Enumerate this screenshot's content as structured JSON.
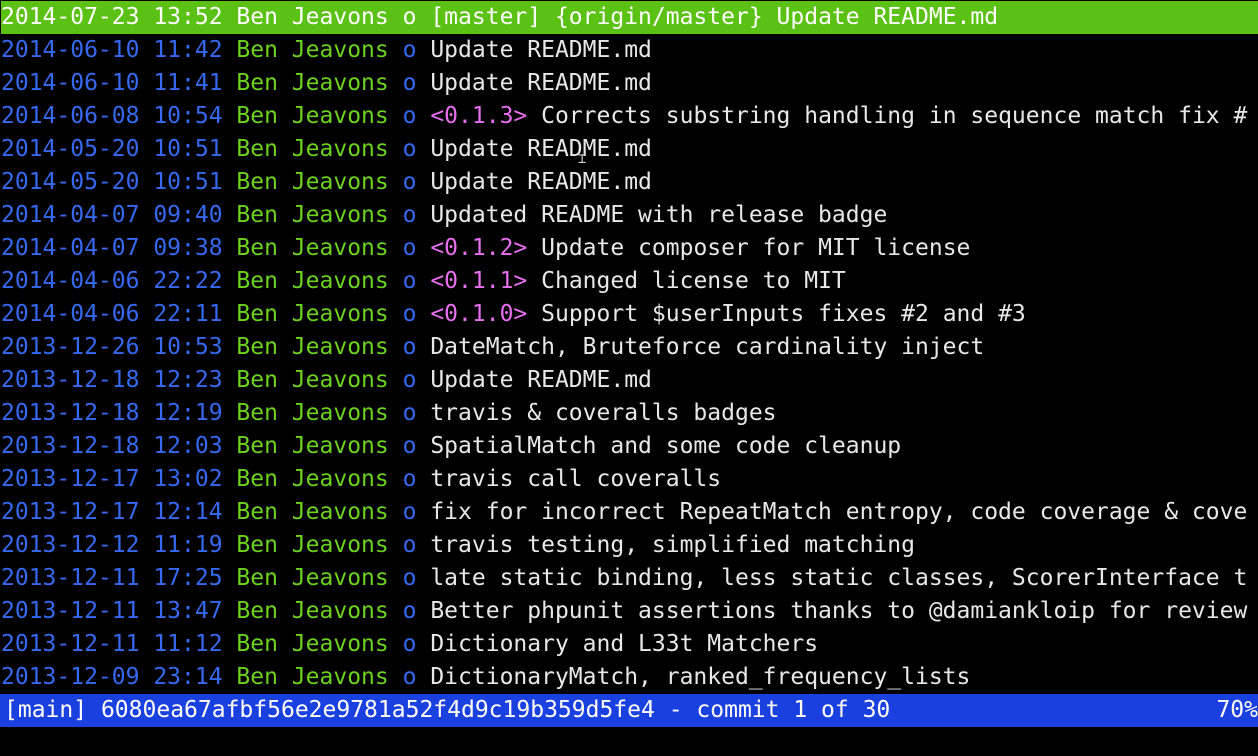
{
  "app": "tig",
  "commits": [
    {
      "date": "2014-07-23 13:52",
      "author": "Ben Jeavons",
      "graph": "o",
      "refs": "[master] {origin/master}",
      "tag": "",
      "subject": "Update README.md",
      "selected": true
    },
    {
      "date": "2014-06-10 11:42",
      "author": "Ben Jeavons",
      "graph": "o",
      "refs": "",
      "tag": "",
      "subject": "Update README.md"
    },
    {
      "date": "2014-06-10 11:41",
      "author": "Ben Jeavons",
      "graph": "o",
      "refs": "",
      "tag": "",
      "subject": "Update README.md"
    },
    {
      "date": "2014-06-08 10:54",
      "author": "Ben Jeavons",
      "graph": "o",
      "refs": "",
      "tag": "<0.1.3>",
      "subject": "Corrects substring handling in sequence match fix #"
    },
    {
      "date": "2014-05-20 10:51",
      "author": "Ben Jeavons",
      "graph": "o",
      "refs": "",
      "tag": "",
      "subject": "Update README.md"
    },
    {
      "date": "2014-05-20 10:51",
      "author": "Ben Jeavons",
      "graph": "o",
      "refs": "",
      "tag": "",
      "subject": "Update README.md"
    },
    {
      "date": "2014-04-07 09:40",
      "author": "Ben Jeavons",
      "graph": "o",
      "refs": "",
      "tag": "",
      "subject": "Updated README with release badge"
    },
    {
      "date": "2014-04-07 09:38",
      "author": "Ben Jeavons",
      "graph": "o",
      "refs": "",
      "tag": "<0.1.2>",
      "subject": "Update composer for MIT license"
    },
    {
      "date": "2014-04-06 22:22",
      "author": "Ben Jeavons",
      "graph": "o",
      "refs": "",
      "tag": "<0.1.1>",
      "subject": "Changed license to MIT"
    },
    {
      "date": "2014-04-06 22:11",
      "author": "Ben Jeavons",
      "graph": "o",
      "refs": "",
      "tag": "<0.1.0>",
      "subject": "Support $userInputs fixes #2 and #3"
    },
    {
      "date": "2013-12-26 10:53",
      "author": "Ben Jeavons",
      "graph": "o",
      "refs": "",
      "tag": "",
      "subject": "DateMatch, Bruteforce cardinality inject"
    },
    {
      "date": "2013-12-18 12:23",
      "author": "Ben Jeavons",
      "graph": "o",
      "refs": "",
      "tag": "",
      "subject": "Update README.md"
    },
    {
      "date": "2013-12-18 12:19",
      "author": "Ben Jeavons",
      "graph": "o",
      "refs": "",
      "tag": "",
      "subject": "travis & coveralls badges"
    },
    {
      "date": "2013-12-18 12:03",
      "author": "Ben Jeavons",
      "graph": "o",
      "refs": "",
      "tag": "",
      "subject": "SpatialMatch and some code cleanup"
    },
    {
      "date": "2013-12-17 13:02",
      "author": "Ben Jeavons",
      "graph": "o",
      "refs": "",
      "tag": "",
      "subject": "travis call coveralls"
    },
    {
      "date": "2013-12-17 12:14",
      "author": "Ben Jeavons",
      "graph": "o",
      "refs": "",
      "tag": "",
      "subject": "fix for incorrect RepeatMatch entropy, code coverage & cove"
    },
    {
      "date": "2013-12-12 11:19",
      "author": "Ben Jeavons",
      "graph": "o",
      "refs": "",
      "tag": "",
      "subject": "travis testing, simplified matching"
    },
    {
      "date": "2013-12-11 17:25",
      "author": "Ben Jeavons",
      "graph": "o",
      "refs": "",
      "tag": "",
      "subject": "late static binding, less static classes, ScorerInterface t"
    },
    {
      "date": "2013-12-11 13:47",
      "author": "Ben Jeavons",
      "graph": "o",
      "refs": "",
      "tag": "",
      "subject": "Better phpunit assertions thanks to @damiankloip for review"
    },
    {
      "date": "2013-12-11 11:12",
      "author": "Ben Jeavons",
      "graph": "o",
      "refs": "",
      "tag": "",
      "subject": "Dictionary and L33t Matchers"
    },
    {
      "date": "2013-12-09 23:14",
      "author": "Ben Jeavons",
      "graph": "o",
      "refs": "",
      "tag": "",
      "subject": "DictionaryMatch, ranked_frequency_lists"
    }
  ],
  "statusbar": {
    "view": "[main]",
    "commit_hash": "6080ea67afbf56e2e9781a52f4d9c19b359d5fe4",
    "position_text": "- commit 1 of 30",
    "percent": "70%"
  },
  "colors": {
    "date": "#3769f0",
    "author": "#6cd21f",
    "tag": "#e86ff0",
    "subject": "#e8e8e8",
    "selected_bg": "#5bc215",
    "statusbar_bg": "#1a40e0"
  },
  "mouse_cursor_icon": "i-beam-cursor-icon"
}
